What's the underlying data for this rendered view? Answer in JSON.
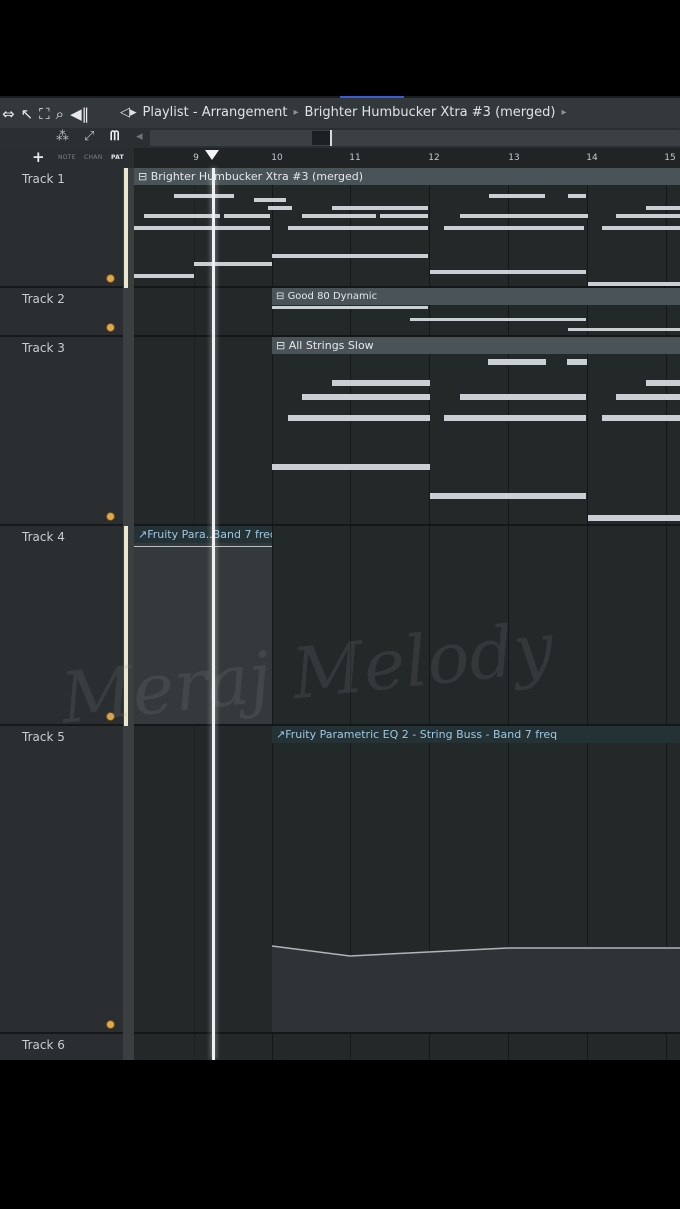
{
  "window": {
    "title": "Playlist - Arrangement",
    "pattern": "Brighter Humbucker Xtra #3 (merged)"
  },
  "toolbar": {
    "labels": {
      "note": "NOTE",
      "chan": "CHAN",
      "pat": "PAT"
    },
    "add_track": "+"
  },
  "ruler": {
    "bars": [
      "9",
      "10",
      "11",
      "12",
      "13",
      "14",
      "15"
    ]
  },
  "tracks": [
    {
      "name": "Track 1",
      "clip": "Brighter Humbucker Xtra #3 (merged)"
    },
    {
      "name": "Track 2",
      "clip": "Good 80 Dynamic"
    },
    {
      "name": "Track 3",
      "clip": "All Strings Slow"
    },
    {
      "name": "Track 4",
      "clip": "Fruity Para..Band 7 freq"
    },
    {
      "name": "Track 5",
      "clip": "Fruity Parametric EQ 2 - String Buss - Band 7 freq"
    },
    {
      "name": "Track 6"
    }
  ],
  "watermark": "Meraj Melody",
  "colors": {
    "accent_blue": "#3a5bd9",
    "mute_dot": "#e0a848",
    "clip_header": "#4a5458",
    "automation_text": "#9fc7e0"
  }
}
